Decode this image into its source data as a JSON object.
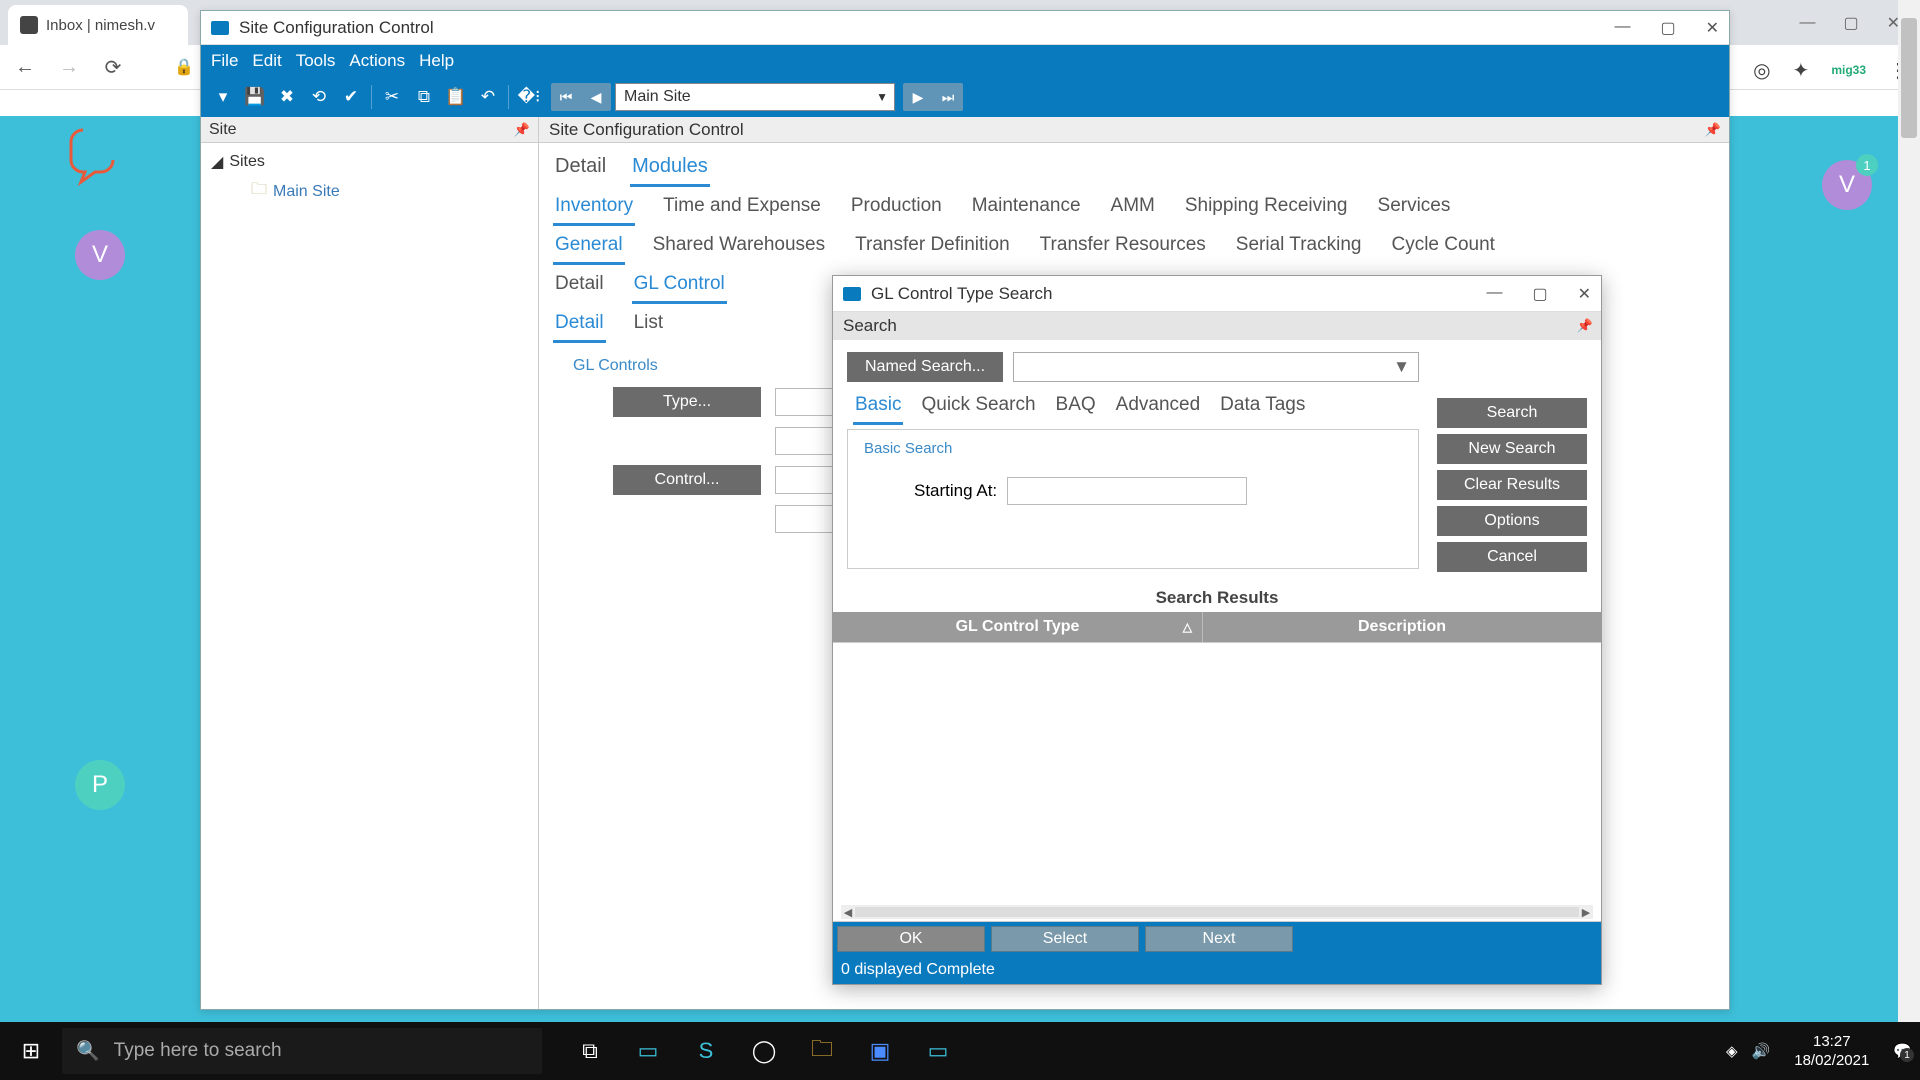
{
  "browser": {
    "tab_title": "Inbox | nimesh.v",
    "win_ctrl": {
      "min": "—",
      "max": "▢",
      "close": "✕"
    },
    "nav": {
      "back": "←",
      "fwd": "→",
      "reload": "⟳",
      "lock": "🔒"
    },
    "ext": {
      "target": "◎",
      "puzzle": "✦",
      "mig": "mig33",
      "menu": "⋮"
    }
  },
  "app": {
    "title": "Site Configuration Control",
    "win_ctrl": {
      "min": "—",
      "max": "▢",
      "close": "✕"
    },
    "menu": {
      "file": "File",
      "edit": "Edit",
      "tools": "Tools",
      "actions": "Actions",
      "help": "Help"
    },
    "toolbar": {
      "site_selected": "Main Site",
      "caret": "▼"
    },
    "tree": {
      "panel": "Site",
      "root": "Sites",
      "child": "Main Site"
    },
    "main_title": "Site Configuration Control",
    "tabs1": {
      "detail": "Detail",
      "modules": "Modules"
    },
    "tabs2": {
      "inventory": "Inventory",
      "time": "Time and Expense",
      "production": "Production",
      "maintenance": "Maintenance",
      "amm": "AMM",
      "shipping": "Shipping Receiving",
      "services": "Services"
    },
    "tabs3": {
      "general": "General",
      "shared": "Shared Warehouses",
      "transfer_def": "Transfer Definition",
      "transfer_res": "Transfer Resources",
      "serial": "Serial Tracking",
      "cycle": "Cycle Count"
    },
    "tabs4": {
      "detail": "Detail",
      "gl": "GL Control"
    },
    "tabs5": {
      "detail": "Detail",
      "list": "List"
    },
    "group": "GL Controls",
    "btn_type": "Type...",
    "btn_control": "Control..."
  },
  "dialog": {
    "title": "GL Control Type Search",
    "win_ctrl": {
      "min": "—",
      "max": "▢",
      "close": "✕"
    },
    "panel": "Search",
    "named": "Named Search...",
    "dd_caret": "▼",
    "tabs": {
      "basic": "Basic",
      "quick": "Quick Search",
      "baq": "BAQ",
      "advanced": "Advanced",
      "tags": "Data Tags"
    },
    "basic_label": "Basic Search",
    "starting": "Starting At:",
    "buttons": {
      "search": "Search",
      "new": "New Search",
      "clear": "Clear Results",
      "options": "Options",
      "cancel": "Cancel"
    },
    "results_hdr": "Search Results",
    "col1": "GL Control Type",
    "col2": "Description",
    "footer": {
      "ok": "OK",
      "select": "Select",
      "next": "Next"
    },
    "status": "0 displayed Complete"
  },
  "avatars": {
    "v": "V",
    "p": "P",
    "badge": "1"
  },
  "taskbar": {
    "search_ph": "Type here to search",
    "time": "13:27",
    "date": "18/02/2021",
    "notif": "1"
  }
}
